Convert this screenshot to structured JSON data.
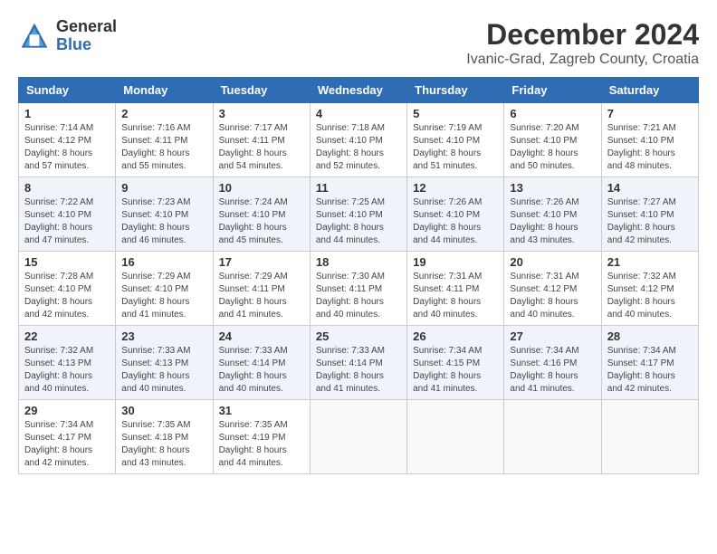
{
  "header": {
    "logo_general": "General",
    "logo_blue": "Blue",
    "month_title": "December 2024",
    "location": "Ivanic-Grad, Zagreb County, Croatia"
  },
  "weekdays": [
    "Sunday",
    "Monday",
    "Tuesday",
    "Wednesday",
    "Thursday",
    "Friday",
    "Saturday"
  ],
  "weeks": [
    [
      {
        "day": "1",
        "sunrise": "Sunrise: 7:14 AM",
        "sunset": "Sunset: 4:12 PM",
        "daylight": "Daylight: 8 hours and 57 minutes."
      },
      {
        "day": "2",
        "sunrise": "Sunrise: 7:16 AM",
        "sunset": "Sunset: 4:11 PM",
        "daylight": "Daylight: 8 hours and 55 minutes."
      },
      {
        "day": "3",
        "sunrise": "Sunrise: 7:17 AM",
        "sunset": "Sunset: 4:11 PM",
        "daylight": "Daylight: 8 hours and 54 minutes."
      },
      {
        "day": "4",
        "sunrise": "Sunrise: 7:18 AM",
        "sunset": "Sunset: 4:10 PM",
        "daylight": "Daylight: 8 hours and 52 minutes."
      },
      {
        "day": "5",
        "sunrise": "Sunrise: 7:19 AM",
        "sunset": "Sunset: 4:10 PM",
        "daylight": "Daylight: 8 hours and 51 minutes."
      },
      {
        "day": "6",
        "sunrise": "Sunrise: 7:20 AM",
        "sunset": "Sunset: 4:10 PM",
        "daylight": "Daylight: 8 hours and 50 minutes."
      },
      {
        "day": "7",
        "sunrise": "Sunrise: 7:21 AM",
        "sunset": "Sunset: 4:10 PM",
        "daylight": "Daylight: 8 hours and 48 minutes."
      }
    ],
    [
      {
        "day": "8",
        "sunrise": "Sunrise: 7:22 AM",
        "sunset": "Sunset: 4:10 PM",
        "daylight": "Daylight: 8 hours and 47 minutes."
      },
      {
        "day": "9",
        "sunrise": "Sunrise: 7:23 AM",
        "sunset": "Sunset: 4:10 PM",
        "daylight": "Daylight: 8 hours and 46 minutes."
      },
      {
        "day": "10",
        "sunrise": "Sunrise: 7:24 AM",
        "sunset": "Sunset: 4:10 PM",
        "daylight": "Daylight: 8 hours and 45 minutes."
      },
      {
        "day": "11",
        "sunrise": "Sunrise: 7:25 AM",
        "sunset": "Sunset: 4:10 PM",
        "daylight": "Daylight: 8 hours and 44 minutes."
      },
      {
        "day": "12",
        "sunrise": "Sunrise: 7:26 AM",
        "sunset": "Sunset: 4:10 PM",
        "daylight": "Daylight: 8 hours and 44 minutes."
      },
      {
        "day": "13",
        "sunrise": "Sunrise: 7:26 AM",
        "sunset": "Sunset: 4:10 PM",
        "daylight": "Daylight: 8 hours and 43 minutes."
      },
      {
        "day": "14",
        "sunrise": "Sunrise: 7:27 AM",
        "sunset": "Sunset: 4:10 PM",
        "daylight": "Daylight: 8 hours and 42 minutes."
      }
    ],
    [
      {
        "day": "15",
        "sunrise": "Sunrise: 7:28 AM",
        "sunset": "Sunset: 4:10 PM",
        "daylight": "Daylight: 8 hours and 42 minutes."
      },
      {
        "day": "16",
        "sunrise": "Sunrise: 7:29 AM",
        "sunset": "Sunset: 4:10 PM",
        "daylight": "Daylight: 8 hours and 41 minutes."
      },
      {
        "day": "17",
        "sunrise": "Sunrise: 7:29 AM",
        "sunset": "Sunset: 4:11 PM",
        "daylight": "Daylight: 8 hours and 41 minutes."
      },
      {
        "day": "18",
        "sunrise": "Sunrise: 7:30 AM",
        "sunset": "Sunset: 4:11 PM",
        "daylight": "Daylight: 8 hours and 40 minutes."
      },
      {
        "day": "19",
        "sunrise": "Sunrise: 7:31 AM",
        "sunset": "Sunset: 4:11 PM",
        "daylight": "Daylight: 8 hours and 40 minutes."
      },
      {
        "day": "20",
        "sunrise": "Sunrise: 7:31 AM",
        "sunset": "Sunset: 4:12 PM",
        "daylight": "Daylight: 8 hours and 40 minutes."
      },
      {
        "day": "21",
        "sunrise": "Sunrise: 7:32 AM",
        "sunset": "Sunset: 4:12 PM",
        "daylight": "Daylight: 8 hours and 40 minutes."
      }
    ],
    [
      {
        "day": "22",
        "sunrise": "Sunrise: 7:32 AM",
        "sunset": "Sunset: 4:13 PM",
        "daylight": "Daylight: 8 hours and 40 minutes."
      },
      {
        "day": "23",
        "sunrise": "Sunrise: 7:33 AM",
        "sunset": "Sunset: 4:13 PM",
        "daylight": "Daylight: 8 hours and 40 minutes."
      },
      {
        "day": "24",
        "sunrise": "Sunrise: 7:33 AM",
        "sunset": "Sunset: 4:14 PM",
        "daylight": "Daylight: 8 hours and 40 minutes."
      },
      {
        "day": "25",
        "sunrise": "Sunrise: 7:33 AM",
        "sunset": "Sunset: 4:14 PM",
        "daylight": "Daylight: 8 hours and 41 minutes."
      },
      {
        "day": "26",
        "sunrise": "Sunrise: 7:34 AM",
        "sunset": "Sunset: 4:15 PM",
        "daylight": "Daylight: 8 hours and 41 minutes."
      },
      {
        "day": "27",
        "sunrise": "Sunrise: 7:34 AM",
        "sunset": "Sunset: 4:16 PM",
        "daylight": "Daylight: 8 hours and 41 minutes."
      },
      {
        "day": "28",
        "sunrise": "Sunrise: 7:34 AM",
        "sunset": "Sunset: 4:17 PM",
        "daylight": "Daylight: 8 hours and 42 minutes."
      }
    ],
    [
      {
        "day": "29",
        "sunrise": "Sunrise: 7:34 AM",
        "sunset": "Sunset: 4:17 PM",
        "daylight": "Daylight: 8 hours and 42 minutes."
      },
      {
        "day": "30",
        "sunrise": "Sunrise: 7:35 AM",
        "sunset": "Sunset: 4:18 PM",
        "daylight": "Daylight: 8 hours and 43 minutes."
      },
      {
        "day": "31",
        "sunrise": "Sunrise: 7:35 AM",
        "sunset": "Sunset: 4:19 PM",
        "daylight": "Daylight: 8 hours and 44 minutes."
      },
      null,
      null,
      null,
      null
    ]
  ]
}
